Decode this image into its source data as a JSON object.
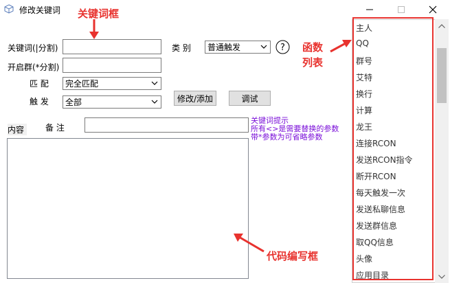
{
  "window": {
    "title": "修改关键词"
  },
  "form": {
    "keyword_label": "关键词(|分割)",
    "keyword_value": "",
    "category_label": "类 别",
    "category_value": "普通触发",
    "groups_label": "开启群(*分割)",
    "groups_value": "",
    "match_label": "匹 配",
    "match_value": "完全匹配",
    "trigger_label": "触 发",
    "trigger_value": "全部",
    "modify_add_button": "修改/添加",
    "debug_button": "调试",
    "content_label": "内容",
    "remark_label": "备 注",
    "remark_value": "",
    "code_value": ""
  },
  "hint": {
    "line1": "关键词提示",
    "line2": "所有<>是需要替换的参数",
    "line3": "带*参数为可省略参数"
  },
  "function_list": [
    "主人",
    "QQ",
    "群号",
    "艾特",
    "换行",
    "计算",
    "龙王",
    "连接RCON",
    "发送RCON指令",
    "断开RCON",
    "每天触发一次",
    "发送私聊信息",
    "发送群信息",
    "取QQ信息",
    "头像",
    "应用目录"
  ],
  "annotations": {
    "keyword_box": "关键词框",
    "function_list_line1": "函数",
    "function_list_line2": "列表",
    "code_box": "代码编写框"
  },
  "colors": {
    "annotation": "#e8322e",
    "hint": "#7b10d9"
  }
}
